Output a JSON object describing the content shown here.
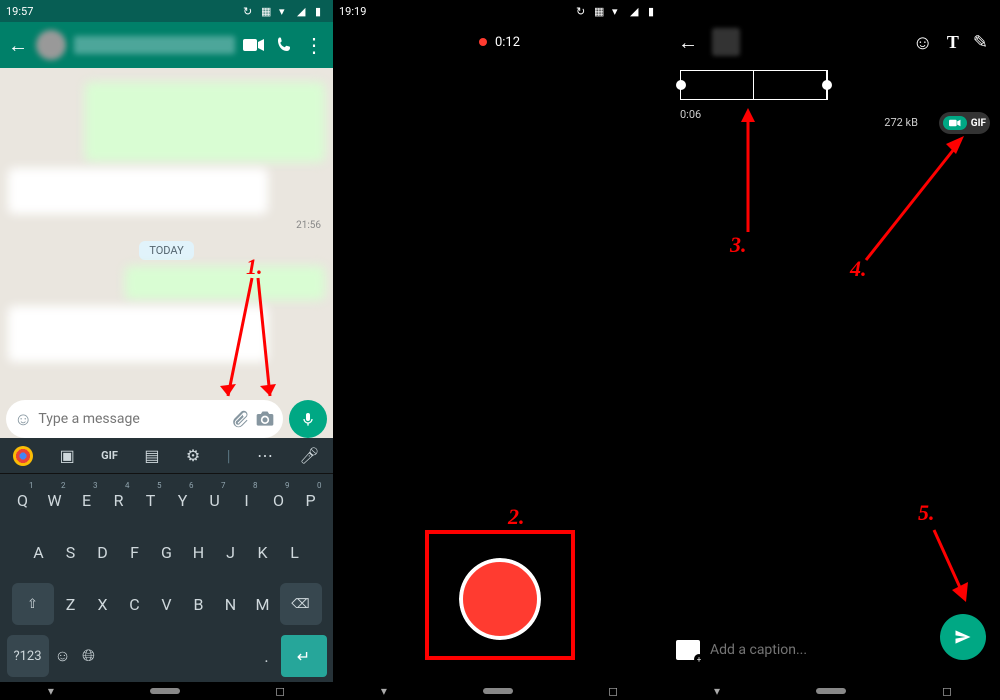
{
  "panel1": {
    "status_time": "19:57",
    "timestamp1": "21:56",
    "today_label": "TODAY",
    "input_placeholder": "Type a message",
    "keyboard": {
      "gif": "GIF",
      "row1": [
        "Q",
        "W",
        "E",
        "R",
        "T",
        "Y",
        "U",
        "I",
        "O",
        "P"
      ],
      "row1_sup": [
        "1",
        "2",
        "3",
        "4",
        "5",
        "6",
        "7",
        "8",
        "9",
        "0"
      ],
      "row2": [
        "A",
        "S",
        "D",
        "F",
        "G",
        "H",
        "J",
        "K",
        "L"
      ],
      "row3": [
        "Z",
        "X",
        "C",
        "V",
        "B",
        "N",
        "M"
      ],
      "symkey": "?123"
    }
  },
  "panel2": {
    "status_time": "19:19",
    "rec_time": "0:12"
  },
  "panel3": {
    "trim_time": "0:06",
    "filesize": "272 kB",
    "gif_label": "GIF",
    "caption_placeholder": "Add a caption..."
  },
  "annotations": {
    "n1": "1.",
    "n2": "2.",
    "n3": "3.",
    "n4": "4.",
    "n5": "5."
  }
}
